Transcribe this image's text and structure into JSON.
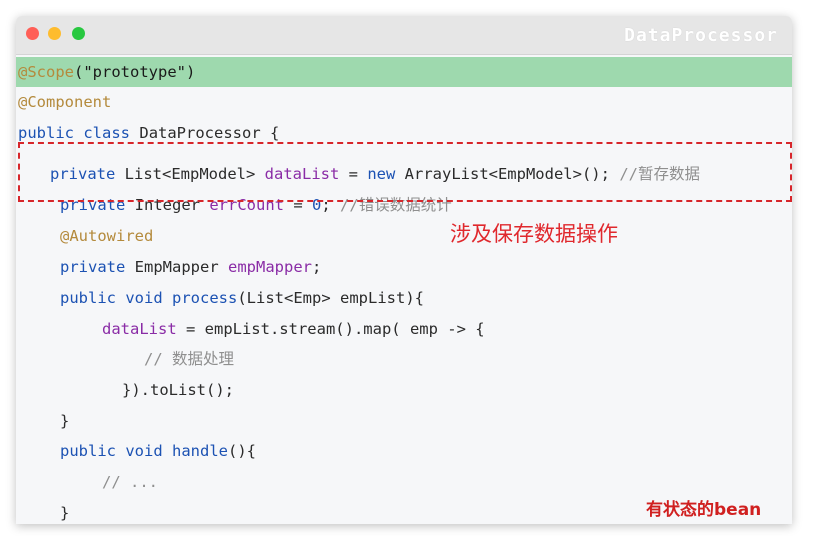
{
  "window": {
    "title": "DataProcessor"
  },
  "code": {
    "line1": {
      "anno": "@Scope",
      "args": "(\"prototype\")"
    },
    "line2": {
      "anno": "@Component"
    },
    "line3": {
      "kw1": "public",
      "kw2": "class",
      "rest": "DataProcessor {"
    },
    "line4": {
      "kw": "private",
      "type": "List<EmpModel>",
      "field": "dataList",
      "eq": " = ",
      "kw2": "new",
      "rest": " ArrayList<EmpModel>();",
      "comment": "//暂存数据"
    },
    "line5": {
      "kw": "private",
      "type": "Integer",
      "field": "errCount",
      "eq": " = ",
      "num": "0",
      "semi": ";",
      "comment": "//错误数据统计"
    },
    "line6": {
      "anno": "@Autowired"
    },
    "line7": {
      "kw": "private",
      "type": "EmpMapper",
      "field": "empMapper",
      "semi": ";"
    },
    "line8": {
      "kw1": "public",
      "kw2": "void",
      "method": "process",
      "rest": "(List<Emp> empList){"
    },
    "line9": {
      "field": "dataList",
      "rest": " = empList.stream().map( emp -> {"
    },
    "line10": {
      "comment": "// 数据处理"
    },
    "line11": {
      "rest": "}).toList();"
    },
    "line12": {
      "rest": "}"
    },
    "line13": {
      "kw1": "public",
      "kw2": "void",
      "method": "handle",
      "rest": "(){"
    },
    "line14": {
      "comment": "// ..."
    },
    "line15": {
      "rest": "}"
    }
  },
  "annotations": {
    "note": "涉及保存数据操作",
    "badge": "有状态的bean"
  },
  "colors": {
    "highlight": "#9ed9ae",
    "keyword": "#1c52b3",
    "annotation": "#b48a3c",
    "field": "#8a2ca6",
    "comment": "#8f8f8f",
    "accent_red": "#e0282d"
  }
}
